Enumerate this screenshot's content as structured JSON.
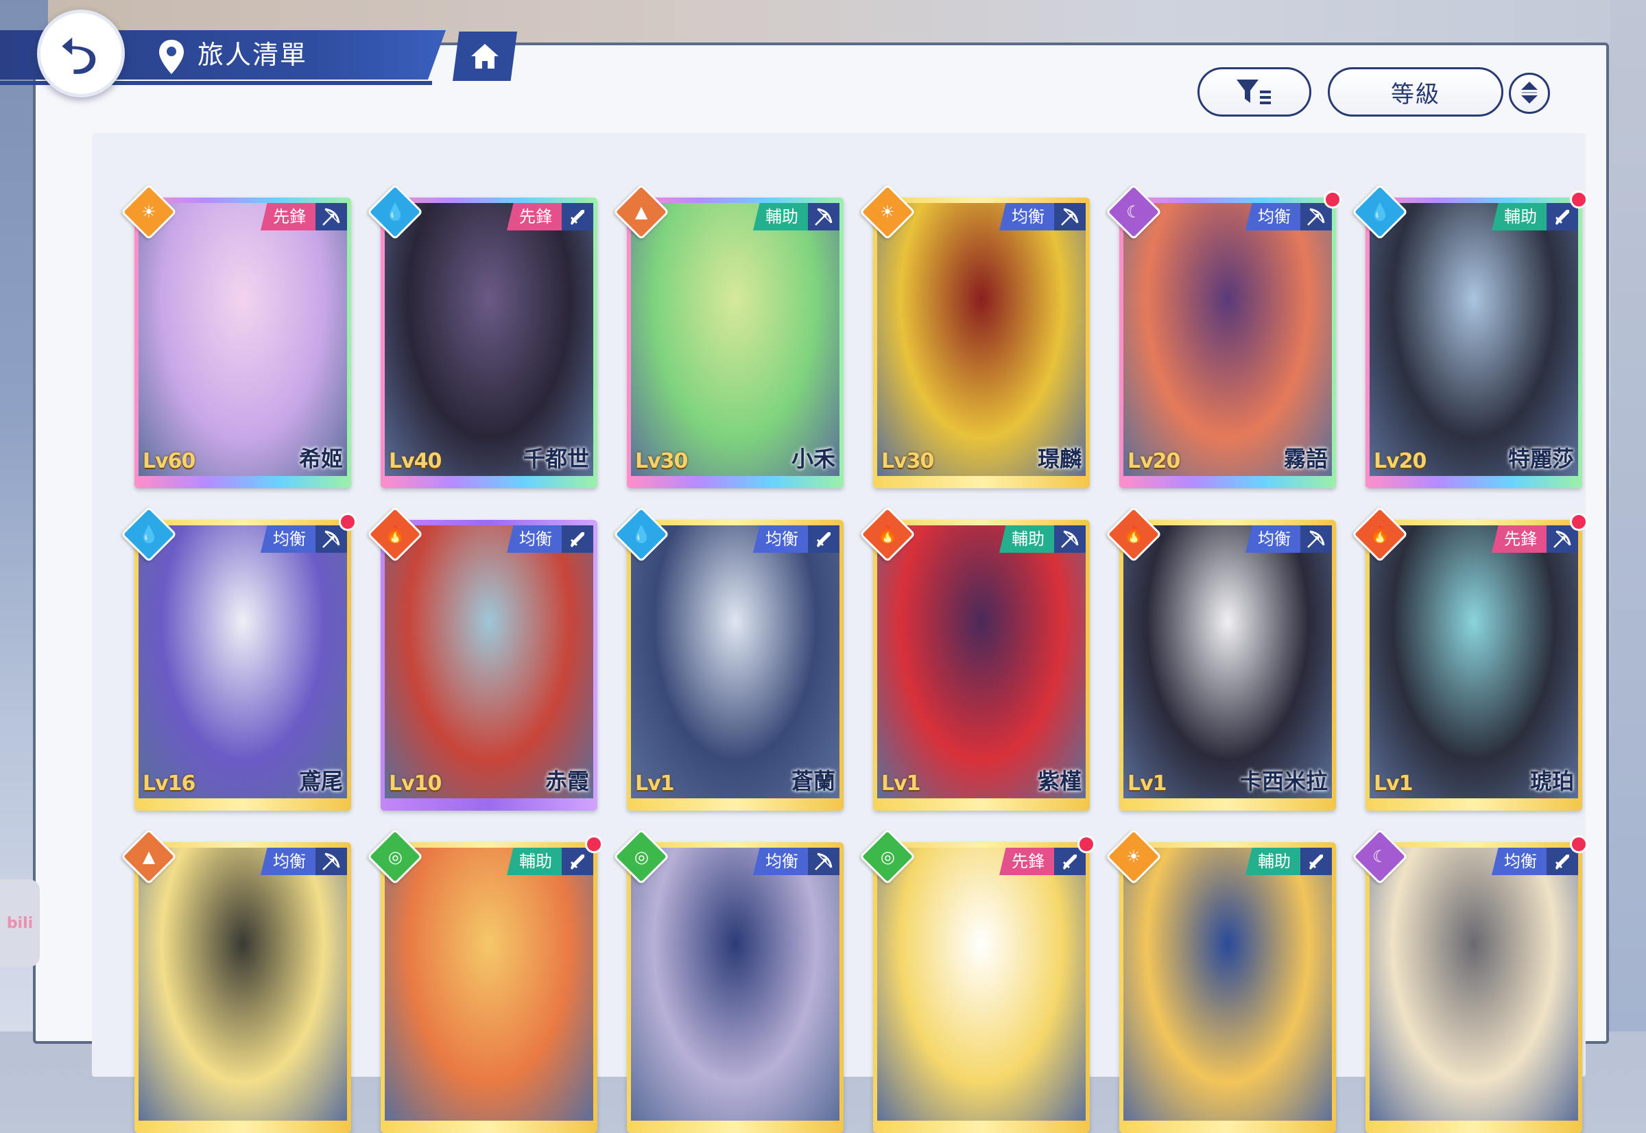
{
  "header": {
    "title": "旅人清單"
  },
  "controls": {
    "sort_label": "等級"
  },
  "side_tab": {
    "label": "bili"
  },
  "colors": {
    "role": {
      "先鋒": "#e4508a",
      "輔助": "#22b08e",
      "均衡": "#4a65d4"
    },
    "element": {
      "sun": "#f59a2b",
      "water": "#2aa8e8",
      "earth": "#e8773c",
      "moon": "#a45bd1",
      "fire": "#ee5a2c",
      "wind": "#3db84a"
    }
  },
  "rarity_gradients": {
    "rainbow": "linear-gradient(90deg,#ff8ec8,#b58cff,#6ad2ff,#9cf0a8)",
    "gold": "linear-gradient(90deg,#f8d55c,#fff1a8,#f3c64a)",
    "purple": "linear-gradient(90deg,#c387f7,#9c6cf0,#d1a4ff)"
  },
  "characters": [
    {
      "name": "希姬",
      "level": "Lv60",
      "role": "先鋒",
      "element": "sun",
      "element_icon": "sun-icon",
      "weapon": "bow-icon",
      "rarity": "rainbow",
      "art": "#c9a7e8",
      "art2": "#f2d4ef",
      "notif": false
    },
    {
      "name": "千都世",
      "level": "Lv40",
      "role": "先鋒",
      "element": "water",
      "element_icon": "water-drop-icon",
      "weapon": "sword-icon",
      "rarity": "rainbow",
      "art": "#2a2638",
      "art2": "#6a5a86",
      "notif": false
    },
    {
      "name": "小禾",
      "level": "Lv30",
      "role": "輔助",
      "element": "earth",
      "element_icon": "mountain-icon",
      "weapon": "bow-icon",
      "rarity": "rainbow",
      "art": "#7fd37e",
      "art2": "#d7e89a",
      "notif": false
    },
    {
      "name": "璟麟",
      "level": "Lv30",
      "role": "均衡",
      "element": "sun",
      "element_icon": "sun-icon",
      "weapon": "bow-icon",
      "rarity": "gold",
      "art": "#e8c23a",
      "art2": "#8a1f1f",
      "notif": false
    },
    {
      "name": "霧語",
      "level": "Lv20",
      "role": "均衡",
      "element": "moon",
      "element_icon": "moon-icon",
      "weapon": "bow-icon",
      "rarity": "rainbow",
      "art": "#e57a5a",
      "art2": "#5a3a7a",
      "notif": true
    },
    {
      "name": "特麗莎",
      "level": "Lv20",
      "role": "輔助",
      "element": "water",
      "element_icon": "water-drop-icon",
      "weapon": "sword-icon",
      "rarity": "rainbow",
      "art": "#2c3040",
      "art2": "#aac4e0",
      "notif": true
    },
    {
      "name": "鳶尾",
      "level": "Lv16",
      "role": "均衡",
      "element": "water",
      "element_icon": "water-drop-icon",
      "weapon": "bow-icon",
      "rarity": "gold",
      "art": "#6b5bc6",
      "art2": "#eef0f6",
      "notif": true
    },
    {
      "name": "赤霞",
      "level": "Lv10",
      "role": "均衡",
      "element": "fire",
      "element_icon": "flame-icon",
      "weapon": "sword-icon",
      "rarity": "purple",
      "art": "#c8453a",
      "art2": "#9ec7d8",
      "notif": false
    },
    {
      "name": "蒼蘭",
      "level": "Lv1",
      "role": "均衡",
      "element": "water",
      "element_icon": "water-drop-icon",
      "weapon": "sword-icon",
      "rarity": "gold",
      "art": "#3a4a78",
      "art2": "#dfe6f1",
      "notif": false
    },
    {
      "name": "紫槿",
      "level": "Lv1",
      "role": "輔助",
      "element": "fire",
      "element_icon": "flame-icon",
      "weapon": "bow-icon",
      "rarity": "gold",
      "art": "#d8313a",
      "art2": "#4a2a5a",
      "notif": false
    },
    {
      "name": "卡西米拉",
      "level": "Lv1",
      "role": "均衡",
      "element": "fire",
      "element_icon": "flame-icon",
      "weapon": "bow-icon",
      "rarity": "gold",
      "art": "#2a2a3a",
      "art2": "#f0f0f4",
      "notif": false
    },
    {
      "name": "琥珀",
      "level": "Lv1",
      "role": "先鋒",
      "element": "fire",
      "element_icon": "flame-icon",
      "weapon": "bow-icon",
      "rarity": "gold",
      "art": "#2b2e3c",
      "art2": "#8ad4dc",
      "notif": true
    },
    {
      "name": "",
      "level": "",
      "role": "均衡",
      "element": "earth",
      "element_icon": "mountain-icon",
      "weapon": "bow-icon",
      "rarity": "gold",
      "art": "#f2de8a",
      "art2": "#3a3a34",
      "notif": false
    },
    {
      "name": "",
      "level": "",
      "role": "輔助",
      "element": "wind",
      "element_icon": "wind-swirl-icon",
      "weapon": "sword-icon",
      "rarity": "gold",
      "art": "#e97a44",
      "art2": "#f4c86a",
      "notif": true
    },
    {
      "name": "",
      "level": "",
      "role": "均衡",
      "element": "wind",
      "element_icon": "wind-swirl-icon",
      "weapon": "bow-icon",
      "rarity": "gold",
      "art": "#b8b0d6",
      "art2": "#2c3c78",
      "notif": false
    },
    {
      "name": "",
      "level": "",
      "role": "先鋒",
      "element": "wind",
      "element_icon": "wind-swirl-icon",
      "weapon": "sword-icon",
      "rarity": "gold",
      "art": "#f5d76a",
      "art2": "#ffffff",
      "notif": true
    },
    {
      "name": "",
      "level": "",
      "role": "輔助",
      "element": "sun",
      "element_icon": "sun-icon",
      "weapon": "sword-icon",
      "rarity": "gold",
      "art": "#f2c45a",
      "art2": "#2a4a9a",
      "notif": false
    },
    {
      "name": "",
      "level": "",
      "role": "均衡",
      "element": "moon",
      "element_icon": "moon-icon",
      "weapon": "sword-icon",
      "rarity": "gold",
      "art": "#efe2c6",
      "art2": "#6a6a72",
      "notif": true
    }
  ]
}
